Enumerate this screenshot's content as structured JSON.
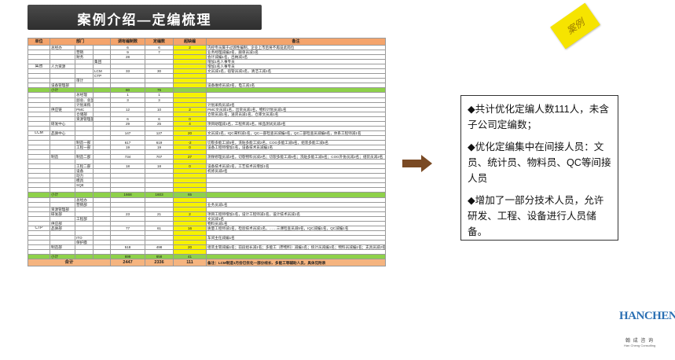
{
  "title": "案例介绍—定编梳理",
  "stamp_text": "案例",
  "table": {
    "headers": [
      "单位",
      "部门",
      "",
      "",
      "调有编制数",
      "定编数",
      "超缺编",
      "备注"
    ],
    "rows": [
      {
        "kind": "row",
        "unit": "",
        "d1": "总经办",
        "d2": "",
        "d3": "",
        "a": "6",
        "b": "6",
        "c": "2",
        "note": "内控专员属于过渡性编制，企业上市后将不再设此岗位"
      },
      {
        "kind": "row",
        "unit": "",
        "d1": "",
        "d2": "营销",
        "d3": "",
        "a": "9",
        "b": "7",
        "c": "",
        "note": "业务经理减编2名，跟单员减1名"
      },
      {
        "kind": "row",
        "unit": "",
        "d1": "",
        "d2": "财务",
        "d3": "",
        "a": "28",
        "b": "",
        "c": "",
        "note": "会计减编1名，出纳减1名"
      },
      {
        "kind": "row",
        "unit": "",
        "d1": "",
        "d2": "",
        "d3": "集团",
        "a": "",
        "b": "",
        "c": "",
        "note": "增加1名人事专员"
      },
      {
        "kind": "row",
        "unit": "集团",
        "d1": "人力资源",
        "d2": "",
        "d3": "",
        "a": "",
        "b": "",
        "c": "",
        "note": "增加1名人事专员"
      },
      {
        "kind": "row",
        "unit": "",
        "d1": "",
        "d2": "",
        "d3": "LCM",
        "a": "33",
        "b": "30",
        "c": "",
        "note": "文员减1名，宿管员减1名，清洁工减1名"
      },
      {
        "kind": "row",
        "unit": "",
        "d1": "",
        "d2": "",
        "d3": "CTP",
        "a": "",
        "b": "",
        "c": "",
        "note": ""
      },
      {
        "kind": "row",
        "unit": "",
        "d1": "",
        "d2": "审计",
        "d3": "",
        "a": "",
        "b": "",
        "c": "",
        "note": ""
      },
      {
        "kind": "row",
        "unit": "",
        "d1": "设备管理部",
        "d2": "",
        "d3": "",
        "a": "",
        "b": "",
        "c": "",
        "note": "设备维修员减2名，电工减1名"
      },
      {
        "kind": "green",
        "unit": "",
        "d1": "小计",
        "d2": "",
        "d3": "",
        "a": "80",
        "b": "75",
        "c": "",
        "note": ""
      },
      {
        "kind": "row",
        "unit": "",
        "d1": "",
        "d2": "总经理",
        "d3": "",
        "a": "1",
        "b": "1",
        "c": "",
        "note": ""
      },
      {
        "kind": "row",
        "unit": "",
        "d1": "",
        "d2": "副总、总监",
        "d3": "",
        "a": "3",
        "b": "3",
        "c": "",
        "note": ""
      },
      {
        "kind": "row",
        "unit": "",
        "d1": "",
        "d2": "计划采购",
        "d3": "",
        "a": "",
        "b": "",
        "c": "",
        "note": "计划采购员减2名"
      },
      {
        "kind": "row",
        "unit": "",
        "d1": "供应链",
        "d2": "PMC",
        "d3": "",
        "a": "12",
        "b": "10",
        "c": "2",
        "note": "PMC文员减1名，出货员减1名，物料计划员减1名"
      },
      {
        "kind": "row",
        "unit": "",
        "d1": "",
        "d2": "仓储部",
        "d3": "",
        "a": "",
        "b": "",
        "c": "",
        "note": "仓管员减1名，送货员减1名，仓库文员减1名"
      },
      {
        "kind": "row",
        "unit": "",
        "d1": "",
        "d2": "资源管理部",
        "d3": "",
        "a": "6",
        "b": "6",
        "c": "0",
        "note": ""
      },
      {
        "kind": "row",
        "unit": "",
        "d1": "研发中心",
        "d2": "",
        "d3": "",
        "a": "29",
        "b": "25",
        "c": "4",
        "note": "项目助理减1名，工程师减1名，样品测试员减2名"
      },
      {
        "kind": "row",
        "unit": "",
        "d1": "",
        "d2": "",
        "d3": "",
        "a": "",
        "b": "",
        "c": "",
        "note": ""
      },
      {
        "kind": "row",
        "unit": "LCM",
        "d1": "品质中心",
        "d2": "",
        "d3": "",
        "a": "147",
        "b": "127",
        "c": "20",
        "note": "文员减1名，IQC来料减1名，QC一部检查员减编4名，QC二部检查员减编6名，体系工程师减1名"
      },
      {
        "kind": "row",
        "unit": "",
        "d1": "",
        "d2": "",
        "d3": "",
        "a": "",
        "b": "",
        "c": "",
        "note": ""
      },
      {
        "kind": "row",
        "unit": "",
        "d1": "",
        "d2": "制造一部",
        "d3": "",
        "a": "617",
        "b": "619",
        "c": "-2",
        "note": "切裂多能工减5名，洗贴多能工减2名，COG多能工减5名，组装多能工减5名"
      },
      {
        "kind": "row",
        "unit": "",
        "d1": "",
        "d2": "工程一部",
        "d3": "",
        "a": "19",
        "b": "19",
        "c": "0",
        "note": "设备工程师增加1名，设备技术员减编1名"
      },
      {
        "kind": "row",
        "unit": "",
        "d1": "",
        "d2": "",
        "d3": "",
        "a": "",
        "b": "",
        "c": "",
        "note": ""
      },
      {
        "kind": "row",
        "unit": "",
        "d1": "制造",
        "d2": "制造二部",
        "d3": "",
        "a": "734",
        "b": "707",
        "c": "27",
        "note": "测保修理员减2名，切裂物料员减2名；切裂多能工减5名；洗贴多能工减5名；COG外协员减2名；组装员减2名"
      },
      {
        "kind": "row",
        "unit": "",
        "d1": "",
        "d2": "",
        "d3": "",
        "a": "",
        "b": "",
        "c": "",
        "note": ""
      },
      {
        "kind": "row",
        "unit": "",
        "d1": "",
        "d2": "工程二部",
        "d3": "",
        "a": "18",
        "b": "18",
        "c": "0",
        "note": "设备技术员减1名，工艺技术员增加1名"
      },
      {
        "kind": "row",
        "unit": "",
        "d1": "",
        "d2": "设备",
        "d3": "",
        "a": "",
        "b": "",
        "c": "",
        "note": "机修员减2名"
      },
      {
        "kind": "row",
        "unit": "",
        "d1": "",
        "d2": "动力",
        "d3": "",
        "a": "",
        "b": "",
        "c": "",
        "note": ""
      },
      {
        "kind": "row",
        "unit": "",
        "d1": "",
        "d2": "模具",
        "d3": "",
        "a": "",
        "b": "",
        "c": "",
        "note": ""
      },
      {
        "kind": "row",
        "unit": "",
        "d1": "",
        "d2": "SQE",
        "d3": "",
        "a": "",
        "b": "",
        "c": "",
        "note": ""
      },
      {
        "kind": "row",
        "unit": "",
        "d1": "",
        "d2": "",
        "d3": "",
        "a": "",
        "b": "",
        "c": "",
        "note": ""
      },
      {
        "kind": "green",
        "unit": "",
        "d1": "小计",
        "d2": "",
        "d3": "",
        "a": "1668",
        "b": "1603",
        "c": "65",
        "note": ""
      },
      {
        "kind": "row",
        "unit": "",
        "d1": "",
        "d2": "总经办",
        "d3": "",
        "a": "",
        "b": "",
        "c": "",
        "note": ""
      },
      {
        "kind": "row",
        "unit": "",
        "d1": "",
        "d2": "营销部",
        "d3": "",
        "a": "",
        "b": "",
        "c": "",
        "note": "业务员减1名"
      },
      {
        "kind": "row",
        "unit": "",
        "d1": "资源管理部",
        "d2": "",
        "d3": "",
        "a": "",
        "b": "",
        "c": "",
        "note": ""
      },
      {
        "kind": "row",
        "unit": "",
        "d1": "研发部",
        "d2": "",
        "d3": "",
        "a": "23",
        "b": "21",
        "c": "2",
        "note": "项目工程师增加1名，设计工程师减1名，设计技术员减1名"
      },
      {
        "kind": "row",
        "unit": "",
        "d1": "",
        "d2": "工程部",
        "d3": "",
        "a": "",
        "b": "",
        "c": "",
        "note": "文员减1名"
      },
      {
        "kind": "row",
        "unit": "",
        "d1": "供应部",
        "d2": "",
        "d3": "",
        "a": "",
        "b": "",
        "c": "",
        "note": "物料员减1名"
      },
      {
        "kind": "row",
        "unit": "CTP",
        "d1": "品质部",
        "d2": "",
        "d3": "",
        "a": "77",
        "b": "61",
        "c": "16",
        "note": "质量工程师减1名，检验技术员减1名，……三课检查员减5名，IQC减编1名，QC减编1名"
      },
      {
        "kind": "row",
        "unit": "",
        "d1": "",
        "d2": "",
        "d3": "",
        "a": "",
        "b": "",
        "c": "",
        "note": ""
      },
      {
        "kind": "row",
        "unit": "",
        "d1": "",
        "d2": "ITO",
        "d3": "",
        "a": "",
        "b": "",
        "c": "",
        "note": "车间主任减编1名"
      },
      {
        "kind": "row",
        "unit": "",
        "d1": "",
        "d2": "保护膜",
        "d3": "",
        "a": "",
        "b": "",
        "c": "",
        "note": ""
      },
      {
        "kind": "row",
        "unit": "",
        "d1": "制造部",
        "d2": "",
        "d3": "",
        "a": "518",
        "b": "498",
        "c": "20",
        "note": "组装主管减编1名；前段组长减1名；多能工（原物料）减编1名；统计员减编1名；物料员减编1名；支具员减2名"
      },
      {
        "kind": "row",
        "unit": "",
        "d1": "",
        "d2": "",
        "d3": "",
        "a": "",
        "b": "",
        "c": "",
        "note": ""
      },
      {
        "kind": "green",
        "unit": "",
        "d1": "小计",
        "d2": "",
        "d3": "",
        "a": "699",
        "b": "658",
        "c": "41",
        "note": ""
      }
    ],
    "total": {
      "label": "合计",
      "a": "2447",
      "b": "2336",
      "c": "111",
      "note": "备注：LCM制造1月份已优化一部分线长、多能工等辅助人员，具体见附表"
    }
  },
  "summary": {
    "bullets": [
      "◆共计优化定编人数111人，未含子公司定编数；",
      "◆优化定编集中在间接人员：文员、统计员、物料员、QC等间接人员",
      "◆增加了一部分技术人员，允许研发、工程、设备进行人员储备。"
    ]
  },
  "logo": {
    "mark": "HANCHENG",
    "cn": "翰 成 咨 询",
    "en": "Han Cheng Consulting"
  },
  "colors": {
    "header": "#f4a46c",
    "subtotal": "#8ed14a",
    "highlight": "#f7f200",
    "arrow": "#7a4a24",
    "stamp": "#f6e400"
  }
}
